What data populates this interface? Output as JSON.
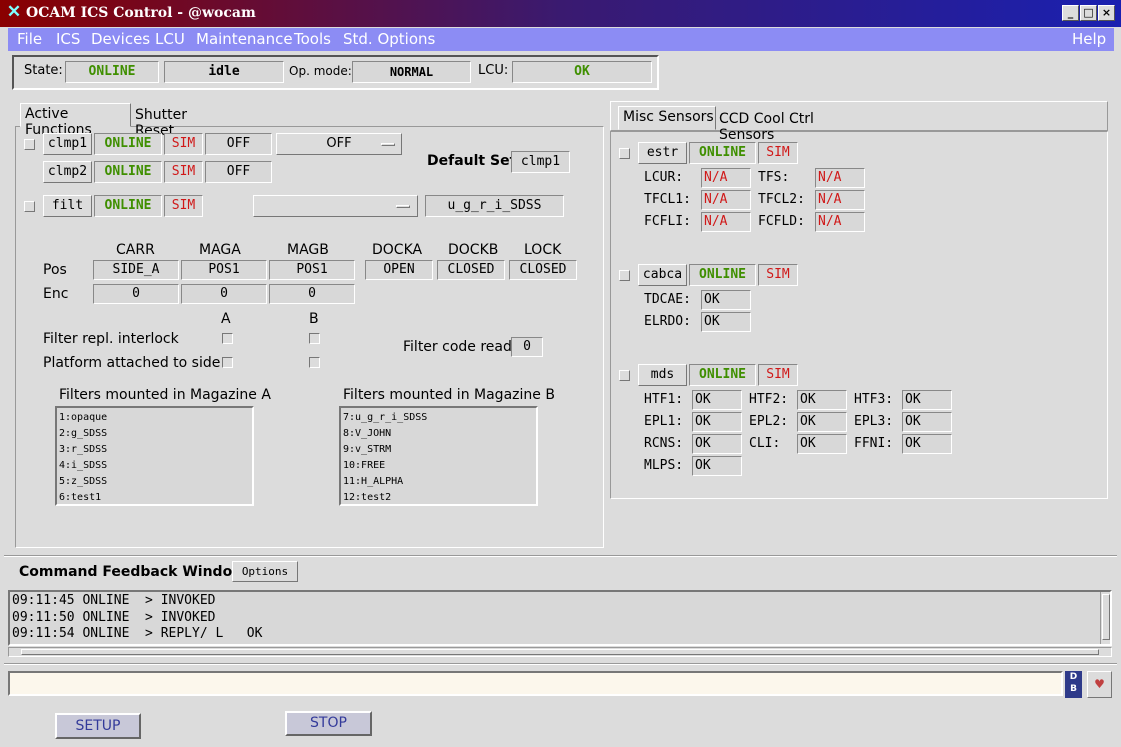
{
  "window": {
    "title": "OCAM ICS Control - @wocam",
    "min": "_",
    "max": "□",
    "close": "×"
  },
  "menu": {
    "items": [
      "File",
      "ICS",
      "Devices",
      "LCU",
      "Maintenance",
      "Tools",
      "Std. Options"
    ],
    "help": "Help"
  },
  "status": {
    "state_label": "State:",
    "state_value": "ONLINE",
    "activity": "idle",
    "opmode_label": "Op. mode:",
    "opmode_value": "NORMAL",
    "lcu_label": "LCU:",
    "lcu_value": "OK"
  },
  "left_tabs": [
    "Active Functions",
    "Shutter Reset"
  ],
  "clmp1": {
    "name": "clmp1",
    "status": "ONLINE",
    "sim": "SIM",
    "value": "OFF",
    "dropdown": "OFF"
  },
  "clmp2": {
    "name": "clmp2",
    "status": "ONLINE",
    "sim": "SIM",
    "value": "OFF"
  },
  "default_set": {
    "label": "Default Set",
    "value": "clmp1"
  },
  "filt": {
    "name": "filt",
    "status": "ONLINE",
    "sim": "SIM",
    "dropdown": "",
    "value": "u_g_r_i_SDSS"
  },
  "axes": {
    "headers": [
      "CARR",
      "MAGA",
      "MAGB",
      "DOCKA",
      "DOCKB",
      "LOCK"
    ],
    "pos_label": "Pos",
    "enc_label": "Enc",
    "pos": [
      "SIDE_A",
      "POS1",
      "POS1",
      "OPEN",
      "CLOSED",
      "CLOSED"
    ],
    "enc": [
      "0",
      "0",
      "0"
    ]
  },
  "interlock": {
    "col_a": "A",
    "col_b": "B",
    "filter_repl": "Filter repl. interlock",
    "platform": "Platform attached to side",
    "code_label": "Filter code read",
    "code_value": "0"
  },
  "magazine_a": {
    "title": "Filters mounted in Magazine A",
    "items": [
      "1:opaque",
      "2:g_SDSS",
      "3:r_SDSS",
      "4:i_SDSS",
      "5:z_SDSS",
      "6:test1"
    ]
  },
  "magazine_b": {
    "title": "Filters mounted in Magazine B",
    "items": [
      "7:u_g_r_i_SDSS",
      "8:V_JOHN",
      "9:v_STRM",
      "10:FREE",
      "11:H_ALPHA",
      "12:test2"
    ]
  },
  "right_tabs": [
    "Misc Sensors",
    "CCD Cool Ctrl Sensors"
  ],
  "estr": {
    "name": "estr",
    "status": "ONLINE",
    "sim": "SIM",
    "sensors": [
      {
        "label": "LCUR:",
        "value": "N/A"
      },
      {
        "label": "TFS:",
        "value": "N/A"
      },
      {
        "label": "TFCL1:",
        "value": "N/A"
      },
      {
        "label": "TFCL2:",
        "value": "N/A"
      },
      {
        "label": "FCFLI:",
        "value": "N/A"
      },
      {
        "label": "FCFLD:",
        "value": "N/A"
      }
    ]
  },
  "cabca": {
    "name": "cabca",
    "status": "ONLINE",
    "sim": "SIM",
    "sensors": [
      {
        "label": "TDCAE:",
        "value": "OK"
      },
      {
        "label": "ELRDO:",
        "value": "OK"
      }
    ]
  },
  "mds": {
    "name": "mds",
    "status": "ONLINE",
    "sim": "SIM",
    "sensors": [
      {
        "label": "HTF1:",
        "value": "OK"
      },
      {
        "label": "HTF2:",
        "value": "OK"
      },
      {
        "label": "HTF3:",
        "value": "OK"
      },
      {
        "label": "EPL1:",
        "value": "OK"
      },
      {
        "label": "EPL2:",
        "value": "OK"
      },
      {
        "label": "EPL3:",
        "value": "OK"
      },
      {
        "label": "RCNS:",
        "value": "OK"
      },
      {
        "label": "CLI:",
        "value": "OK"
      },
      {
        "label": "FFNI:",
        "value": "OK"
      },
      {
        "label": "MLPS:",
        "value": "OK"
      }
    ]
  },
  "feedback": {
    "title": "Command Feedback Window",
    "options": "Options",
    "lines": [
      "09:11:45 ONLINE  > INVOKED",
      "09:11:50 ONLINE  > INVOKED",
      "09:11:54 ONLINE  > REPLY/ L   OK"
    ],
    "command_input": "",
    "db_icon": "D B"
  },
  "buttons": {
    "setup": "SETUP",
    "stop": "STOP"
  }
}
